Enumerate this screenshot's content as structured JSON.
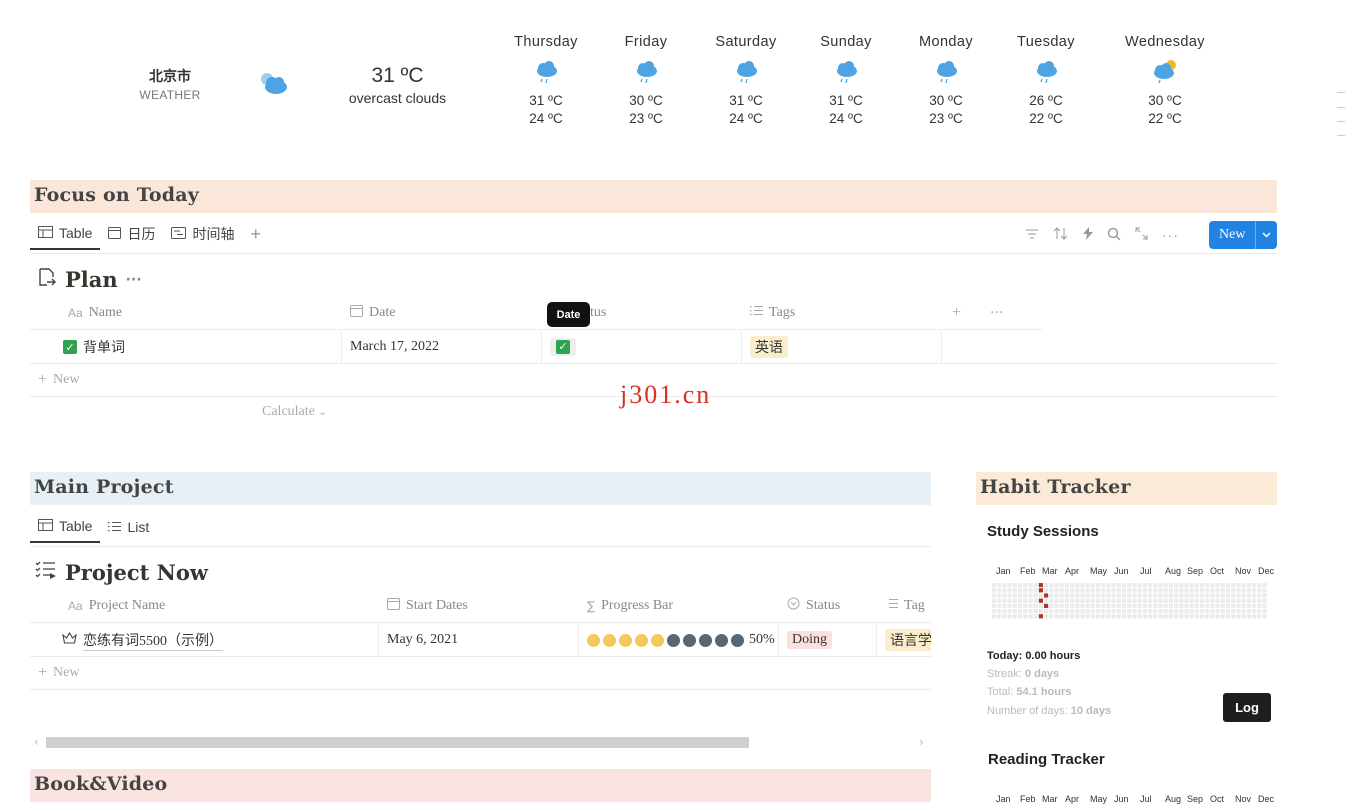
{
  "weather": {
    "city": "北京市",
    "label": "WEATHER",
    "current_temp": "31 ºC",
    "current_desc": "overcast clouds",
    "forecast": [
      {
        "day": "Thursday",
        "high": "31 ºC",
        "low": "24 ºC",
        "icon": "rain-cloud-icon"
      },
      {
        "day": "Friday",
        "high": "30 ºC",
        "low": "23 ºC",
        "icon": "rain-cloud-icon"
      },
      {
        "day": "Saturday",
        "high": "31 ºC",
        "low": "24 ºC",
        "icon": "rain-cloud-icon"
      },
      {
        "day": "Sunday",
        "high": "31 ºC",
        "low": "24 ºC",
        "icon": "rain-cloud-icon"
      },
      {
        "day": "Monday",
        "high": "30 ºC",
        "low": "23 ºC",
        "icon": "rain-cloud-icon"
      },
      {
        "day": "Tuesday",
        "high": "26 ºC",
        "low": "22 ºC",
        "icon": "rain-cloud-icon"
      },
      {
        "day": "Wednesday",
        "high": "30 ºC",
        "low": "22 ºC",
        "icon": "sun-rain-cloud-icon"
      }
    ]
  },
  "focus": {
    "heading": "Focus on Today",
    "tabs": [
      "Table",
      "日历",
      "时间轴"
    ],
    "new_label": "New",
    "db_title": "Plan",
    "columns": [
      "Name",
      "Date",
      "Status",
      "Tags"
    ],
    "columns_visible": [
      "Name",
      "Date",
      "tus",
      "Tags"
    ],
    "tooltip": "Date",
    "rows": [
      {
        "name": "背单词",
        "date": "March 17, 2022",
        "status": "✓",
        "tag": "英语"
      }
    ],
    "add_row": "New",
    "calculate": "Calculate"
  },
  "watermark": "j301.cn",
  "main": {
    "heading": "Main Project",
    "tabs": [
      "Table",
      "List"
    ],
    "db_title": "Project Now",
    "columns": [
      "Project Name",
      "Start Dates",
      "Progress Bar",
      "Status",
      "Tag"
    ],
    "rows": [
      {
        "name": "恋练有词5500（示例）",
        "start": "May 6, 2021",
        "progress": 0.5,
        "progress_text": "50%",
        "status": "Doing",
        "tag": "语言学"
      }
    ],
    "add_row": "New"
  },
  "book": {
    "heading": "Book&Video"
  },
  "habit": {
    "heading": "Habit Tracker",
    "tracker1": "Study Sessions",
    "months": [
      "Jan",
      "Feb",
      "Mar",
      "Apr",
      "May",
      "Jun",
      "Jul",
      "Aug",
      "Sep",
      "Oct",
      "Nov",
      "Dec"
    ],
    "today_label": "Today:",
    "today_value": "0.00 hours",
    "streak_label": "Streak:",
    "streak_value": "0 days",
    "total_label": "Total:",
    "total_value": "54.1 hours",
    "days_label": "Number of days:",
    "days_value": "10 days",
    "log_label": "Log",
    "tracker2": "Reading Tracker"
  },
  "colors": {
    "accent": "#2383e2",
    "dot_filled": "#f2c75c",
    "dot_empty": "#546875",
    "habit_active": "#a8392c"
  }
}
